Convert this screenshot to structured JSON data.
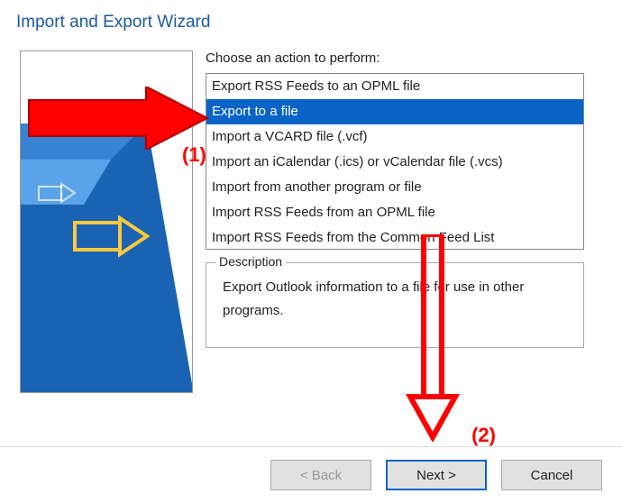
{
  "title": "Import and Export Wizard",
  "prompt": "Choose an action to perform:",
  "list": {
    "selectedIndex": 1,
    "items": [
      "Export RSS Feeds to an OPML file",
      "Export to a file",
      "Import a VCARD file (.vcf)",
      "Import an iCalendar (.ics) or vCalendar file (.vcs)",
      "Import from another program or file",
      "Import RSS Feeds from an OPML file",
      "Import RSS Feeds from the Common Feed List"
    ]
  },
  "description": {
    "legend": "Description",
    "text": "Export Outlook information to a file for use in other programs."
  },
  "buttons": {
    "back": "< Back",
    "next": "Next >",
    "cancel": "Cancel"
  },
  "annotations": {
    "label1": "(1)",
    "label2": "(2)"
  }
}
